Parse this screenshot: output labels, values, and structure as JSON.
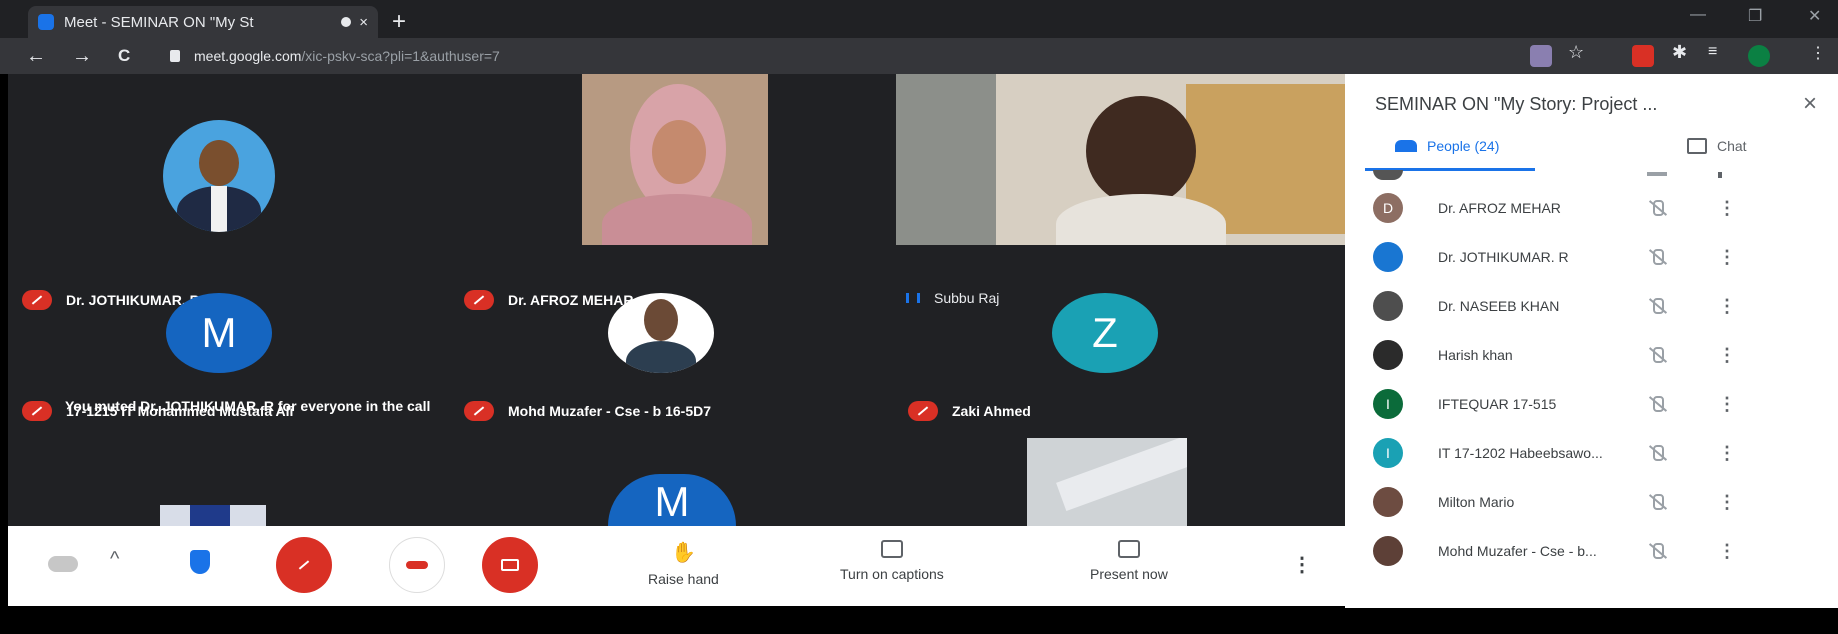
{
  "browser": {
    "tab_title": "Meet - SEMINAR ON \"My St",
    "tab_close": "×",
    "new_tab": "+",
    "url_host": "meet.google.com",
    "url_path": "/xic-pskv-sca?pli=1&authuser=7",
    "nav_back": "←",
    "nav_forward": "→",
    "nav_reload": "C",
    "win_minimize": "—",
    "win_restore": "❐",
    "win_close": "✕"
  },
  "tiles": [
    {
      "name": "Dr. JOTHIKUMAR. R"
    },
    {
      "name": "Dr. AFROZ MEHAR"
    },
    {
      "name": "Subbu Raj"
    },
    {
      "name": "17-1215 IT Mohammed Mustafa Ali",
      "initial": "M"
    },
    {
      "name": "Mohd Muzafer - Cse - b 16-5D7"
    },
    {
      "name": "Zaki Ahmed",
      "initial": "Z"
    },
    {
      "initial": "M"
    }
  ],
  "toast": "You muted Dr. JOTHIKUMAR. R for everyone in the call",
  "controls": {
    "raise_hand": "Raise hand",
    "captions": "Turn on captions",
    "present": "Present now",
    "more": "⋮",
    "expand": "^"
  },
  "panel": {
    "title": "SEMINAR ON \"My Story: Project ...",
    "close": "×",
    "people_tab": "People (24)",
    "chat_tab": "Chat",
    "people": [
      {
        "name": "Dr. AFROZ MEHAR",
        "initial": "D",
        "color": "#8d6e63"
      },
      {
        "name": "Dr. JOTHIKUMAR. R",
        "initial": "",
        "color": "#1976d2"
      },
      {
        "name": "Dr. NASEEB KHAN",
        "initial": "",
        "color": "#4e4e4e"
      },
      {
        "name": "Harish khan",
        "initial": "",
        "color": "#2b2b2b"
      },
      {
        "name": "IFTEQUAR 17-515",
        "initial": "I",
        "color": "#0b6b3a"
      },
      {
        "name": "IT 17-1202 Habeebsawo...",
        "initial": "I",
        "color": "#1aa1b4"
      },
      {
        "name": "Milton Mario",
        "initial": "",
        "color": "#6d4c41"
      },
      {
        "name": "Mohd Muzafer - Cse - b...",
        "initial": "",
        "color": "#5d4037"
      }
    ],
    "more_glyph": "⋮"
  },
  "colors": {
    "accent": "#1a73e8",
    "danger": "#d93025",
    "stage_bg": "#202124"
  }
}
